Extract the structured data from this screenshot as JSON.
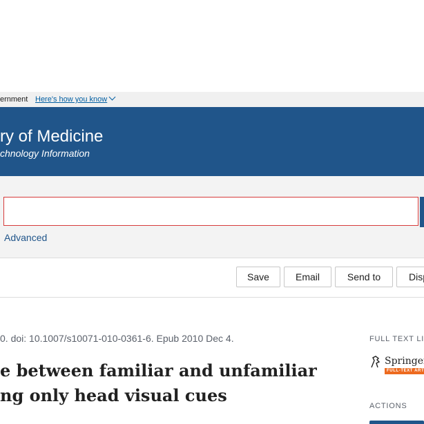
{
  "gov_banner": {
    "text": "ernment",
    "link": "Here's how you know"
  },
  "header": {
    "title": "ry of Medicine",
    "subtitle": "chnology Information"
  },
  "search": {
    "value": "",
    "advanced_label": "Advanced"
  },
  "toolbar": {
    "save_label": "Save",
    "email_label": "Email",
    "send_to_label": "Send to",
    "display_label": "Disp"
  },
  "article": {
    "citation": "0. doi: 10.1007/s10071-010-0361-6. Epub 2010 Dec 4.",
    "title_line1": "e between familiar and unfamiliar",
    "title_line2": "ng only head visual cues"
  },
  "sidebar": {
    "full_text_label": "FULL TEXT LIN",
    "springer_name": "Springer",
    "springer_tag": "FULL-TEXT ARTICLE",
    "actions_label": "ACTIONS"
  },
  "colors": {
    "brand_blue": "#20558a",
    "link_blue": "#005ea2",
    "search_border": "#d63a3a",
    "springer_orange": "#ed6a1f"
  }
}
